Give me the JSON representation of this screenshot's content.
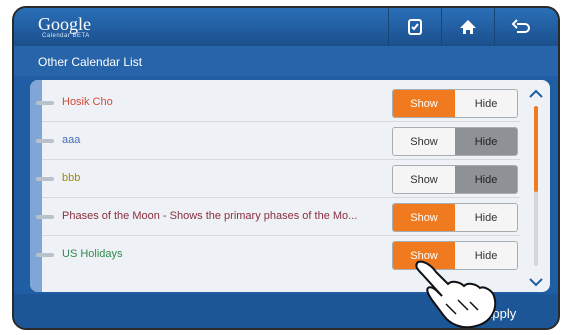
{
  "header": {
    "logo_text": "Google",
    "logo_sub": "Calendar BETA",
    "icons": [
      "calendar-check-icon",
      "home-icon",
      "back-arrow-icon"
    ]
  },
  "subtitle": "Other Calendar List",
  "rows": [
    {
      "name": "Hosik Cho",
      "color": "#d64a3a",
      "state": "show"
    },
    {
      "name": "aaa",
      "color": "#4b6fb4",
      "state": "hide"
    },
    {
      "name": "bbb",
      "color": "#9c8b16",
      "state": "hide"
    },
    {
      "name": "Phases of the Moon - Shows the primary phases of the Mo...",
      "color": "#8a2f3e",
      "state": "show"
    },
    {
      "name": "US Holidays",
      "color": "#2f8a4d",
      "state": "show"
    }
  ],
  "labels": {
    "show": "Show",
    "hide": "Hide"
  },
  "footer": {
    "apply": "Apply"
  },
  "colors": {
    "accent_orange": "#f07a1f",
    "header_blue": "#1f5ea4",
    "hide_active": "#8e9297"
  }
}
